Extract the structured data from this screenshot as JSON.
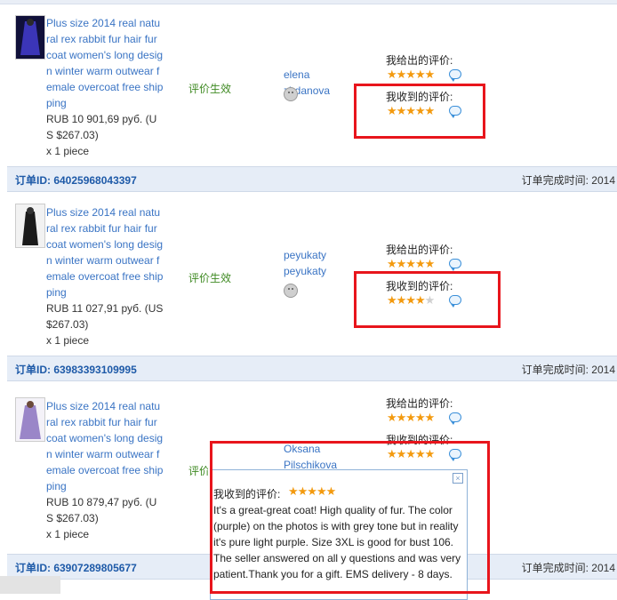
{
  "orders": [
    {
      "title": "Plus size 2014 real natural rex rabbit fur hair fur coat women's long design winter warm outwear female overcoat free shipping",
      "price": "RUB 10 901,69 руб. (US $267.03)",
      "qty": "x 1 piece",
      "status": "评价生效",
      "buyer": "elena zhdanova",
      "given_label": "我给出的评价:",
      "received_label": "我收到的评价:",
      "given_stars": "★★★★★",
      "received_stars": "★★★★★",
      "thumb_color": "#3b35b8"
    },
    {
      "title": "Plus size 2014 real natural rex rabbit fur hair fur coat women's long design winter warm outwear female overcoat free shipping",
      "price": "RUB 11 027,91 руб. (US $267.03)",
      "qty": "x 1 piece",
      "status": "评价生效",
      "buyer": "peyukaty peyukaty",
      "given_label": "我给出的评价:",
      "received_label": "我收到的评价:",
      "given_stars": "★★★★★",
      "received_stars_on": "★★★★",
      "received_stars_off": "★",
      "thumb_color": "#1b1b1b"
    },
    {
      "title": "Plus size 2014 real natural rex rabbit fur hair fur coat women's long design winter warm outwear female overcoat free shipping",
      "price": "RUB 10 879,47 руб. (US $267.03)",
      "qty": "x 1 piece",
      "status": "评价生效",
      "buyer": "Oksana Pilschikova",
      "given_label": "我给出的评价:",
      "received_label": "我收到的评价:",
      "given_stars": "★★★★★",
      "received_stars": "★★★★★",
      "thumb_color": "#9a86c8"
    }
  ],
  "order_bars": [
    {
      "id": "订单ID: 64025968043397",
      "time": "订单完成时间: 2014"
    },
    {
      "id": "订单ID: 63983393109995",
      "time": "订单完成时间: 2014"
    },
    {
      "id": "订单ID: 63907289805677",
      "time": "订单完成时间: 2014"
    }
  ],
  "popup": {
    "label": "我收到的评价:",
    "stars": "★★★★★",
    "text": "It's a great-great coat! High quality of fur. The color (purple) on the photos is with grey tone but in reality it's pure light purple. Size 3XL is good for bust 106. The seller answered on all y questions and was very patient.Thank you for a gift. EMS delivery - 8 days.",
    "close": "×"
  },
  "colors": {
    "link": "#3a74c4",
    "status": "#3f8a23",
    "star": "#f39a0f",
    "highlight": "#e8151c"
  }
}
